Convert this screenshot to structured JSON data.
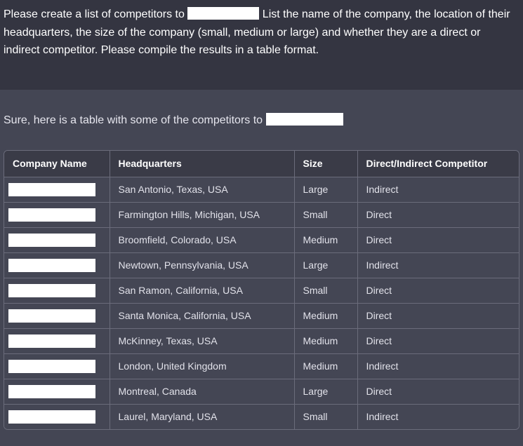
{
  "conversation": {
    "user_prompt": {
      "part1": "Please create a list of competitors to ",
      "part2": " List the name of the company, the location of their headquarters, the size of the company (small, medium or large) and whether they are a direct or indirect competitor. Please compile the results in a table format."
    },
    "assistant_reply": {
      "intro": "Sure, here is a table with some of the competitors to "
    }
  },
  "table": {
    "headers": [
      "Company Name",
      "Headquarters",
      "Size",
      "Direct/Indirect Competitor"
    ],
    "rows": [
      {
        "headquarters": "San Antonio, Texas, USA",
        "size": "Large",
        "competitor": "Indirect"
      },
      {
        "headquarters": "Farmington Hills, Michigan, USA",
        "size": "Small",
        "competitor": "Direct"
      },
      {
        "headquarters": "Broomfield, Colorado, USA",
        "size": "Medium",
        "competitor": "Direct"
      },
      {
        "headquarters": "Newtown, Pennsylvania, USA",
        "size": "Large",
        "competitor": "Indirect"
      },
      {
        "headquarters": "San Ramon, California, USA",
        "size": "Small",
        "competitor": "Direct"
      },
      {
        "headquarters": "Santa Monica, California, USA",
        "size": "Medium",
        "competitor": "Direct"
      },
      {
        "headquarters": "McKinney, Texas, USA",
        "size": "Medium",
        "competitor": "Direct"
      },
      {
        "headquarters": "London, United Kingdom",
        "size": "Medium",
        "competitor": "Indirect"
      },
      {
        "headquarters": "Montreal, Canada",
        "size": "Large",
        "competitor": "Direct"
      },
      {
        "headquarters": "Laurel, Maryland, USA",
        "size": "Small",
        "competitor": "Indirect"
      }
    ]
  },
  "colors": {
    "user_bg": "#343541",
    "assistant_bg": "#444654",
    "border": "#6b6c7b",
    "redaction": "#ffffff"
  }
}
